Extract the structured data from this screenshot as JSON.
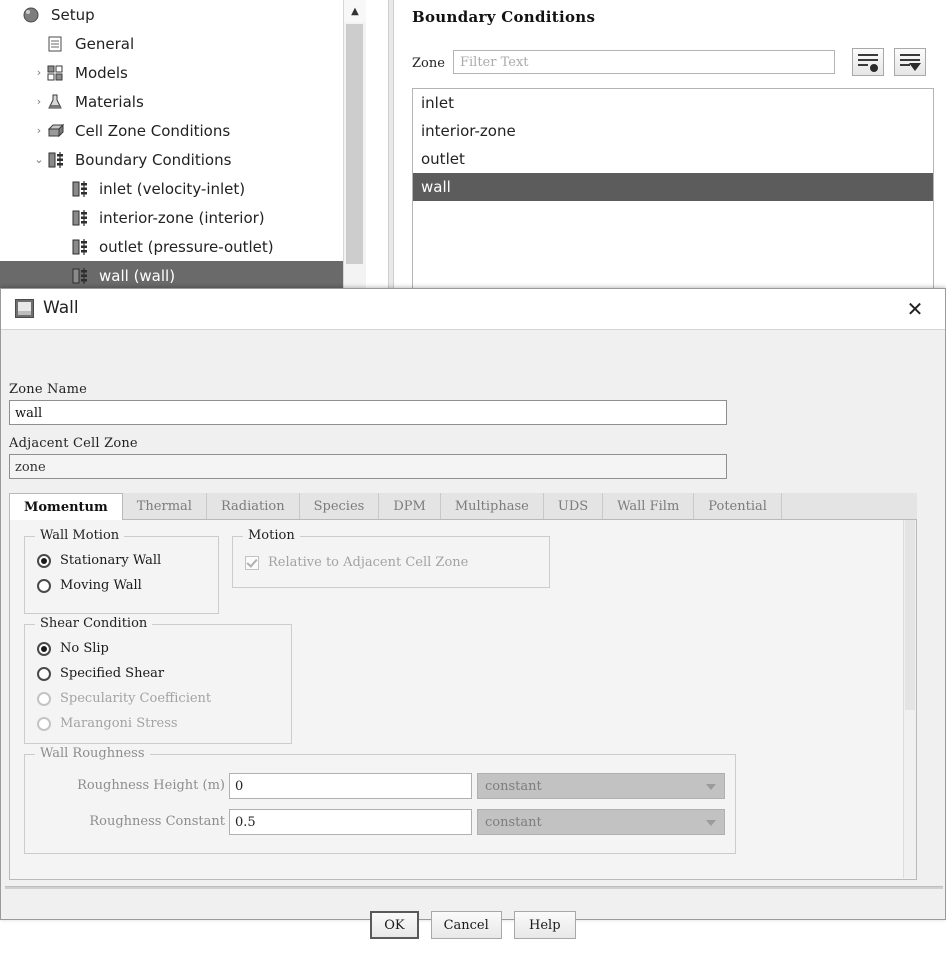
{
  "tree": {
    "items": [
      {
        "label": "Setup",
        "icon": "setup-icon",
        "arrow": "",
        "indent": 0,
        "selected": false
      },
      {
        "label": "General",
        "icon": "general-icon",
        "arrow": "",
        "indent": 1,
        "selected": false
      },
      {
        "label": "Models",
        "icon": "models-icon",
        "arrow": "›",
        "indent": 1,
        "selected": false
      },
      {
        "label": "Materials",
        "icon": "materials-icon",
        "arrow": "›",
        "indent": 1,
        "selected": false
      },
      {
        "label": "Cell Zone Conditions",
        "icon": "cellzone-icon",
        "arrow": "›",
        "indent": 1,
        "selected": false
      },
      {
        "label": "Boundary Conditions",
        "icon": "boundary-icon",
        "arrow": "⌄",
        "indent": 1,
        "selected": false
      },
      {
        "label": "inlet (velocity-inlet)",
        "icon": "boundary-icon",
        "arrow": "",
        "indent": 2,
        "selected": false
      },
      {
        "label": "interior-zone (interior)",
        "icon": "boundary-icon",
        "arrow": "",
        "indent": 2,
        "selected": false
      },
      {
        "label": "outlet (pressure-outlet)",
        "icon": "boundary-icon",
        "arrow": "",
        "indent": 2,
        "selected": false
      },
      {
        "label": "wall (wall)",
        "icon": "boundary-icon",
        "arrow": "",
        "indent": 2,
        "selected": true
      }
    ],
    "scroll_up_glyph": "▲"
  },
  "boundary_panel": {
    "title": "Boundary Conditions",
    "zone_label": "Zone",
    "filter_placeholder": "Filter Text",
    "filter_value": "",
    "tool_buttons": [
      {
        "name": "list-options-button"
      },
      {
        "name": "list-sort-button"
      }
    ],
    "zones": [
      {
        "label": "inlet",
        "selected": false
      },
      {
        "label": "interior-zone",
        "selected": false
      },
      {
        "label": "outlet",
        "selected": false
      },
      {
        "label": "wall",
        "selected": true
      }
    ]
  },
  "dialog": {
    "title": "Wall",
    "close_glyph": "✕",
    "zone_name_label": "Zone Name",
    "zone_name_value": "wall",
    "adjacent_cell_zone_label": "Adjacent Cell Zone",
    "adjacent_cell_zone_value": "zone",
    "tabs": [
      {
        "label": "Momentum",
        "active": true
      },
      {
        "label": "Thermal",
        "active": false
      },
      {
        "label": "Radiation",
        "active": false
      },
      {
        "label": "Species",
        "active": false
      },
      {
        "label": "DPM",
        "active": false
      },
      {
        "label": "Multiphase",
        "active": false
      },
      {
        "label": "UDS",
        "active": false
      },
      {
        "label": "Wall Film",
        "active": false
      },
      {
        "label": "Potential",
        "active": false
      }
    ],
    "wall_motion": {
      "title": "Wall Motion",
      "options": [
        {
          "label": "Stationary Wall",
          "checked": true,
          "disabled": false
        },
        {
          "label": "Moving Wall",
          "checked": false,
          "disabled": false
        }
      ]
    },
    "motion": {
      "title": "Motion",
      "checkbox_label": "Relative to Adjacent Cell Zone",
      "checkbox_checked": true,
      "checkbox_disabled": true
    },
    "shear_condition": {
      "title": "Shear Condition",
      "options": [
        {
          "label": "No Slip",
          "checked": true,
          "disabled": false
        },
        {
          "label": "Specified Shear",
          "checked": false,
          "disabled": false
        },
        {
          "label": "Specularity Coefficient",
          "checked": false,
          "disabled": true
        },
        {
          "label": "Marangoni Stress",
          "checked": false,
          "disabled": true
        }
      ]
    },
    "wall_roughness": {
      "title": "Wall Roughness",
      "rows": [
        {
          "label": "Roughness Height (m)",
          "value": "0",
          "mode": "constant"
        },
        {
          "label": "Roughness Constant",
          "value": "0.5",
          "mode": "constant"
        }
      ]
    },
    "buttons": [
      {
        "label": "OK",
        "default": true
      },
      {
        "label": "Cancel",
        "default": false
      },
      {
        "label": "Help",
        "default": false
      }
    ]
  },
  "colors": {
    "selection": "#5c5c5c",
    "tree_selection": "#6a6a6a",
    "dialog_bg": "#f0f0f0",
    "panel_bg": "#f4f4f4",
    "disabled_text": "#8d8d8d"
  }
}
